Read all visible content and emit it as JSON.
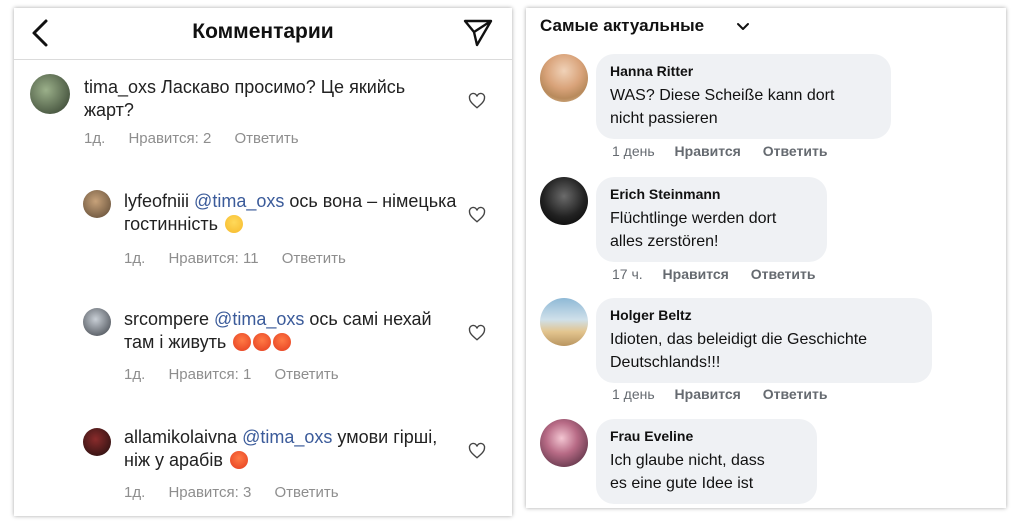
{
  "instagram": {
    "title": "Комментарии",
    "comments": [
      {
        "user": "tima_oxs",
        "mention": "",
        "text": "Ласкаво просимо? Це якийсь жарт?",
        "emoji": [],
        "time": "1д.",
        "likes": "Нравится: 2",
        "reply": "Ответить"
      },
      {
        "user": "lyfeofniii",
        "mention": "@tima_oxs",
        "text": "ось вона – німецька гостинність",
        "emoji": [
          "crying-face"
        ],
        "time": "1д.",
        "likes": "Нравится: 11",
        "reply": "Ответить"
      },
      {
        "user": "srcompere",
        "mention": "@tima_oxs",
        "text": "ось самі нехай там і живуть",
        "emoji": [
          "angry-face",
          "angry-face",
          "angry-face"
        ],
        "time": "1д.",
        "likes": "Нравится: 1",
        "reply": "Ответить"
      },
      {
        "user": "allamikolaivna",
        "mention": "@tima_oxs",
        "text": "умови гірші, ніж у арабів",
        "emoji": [
          "angry-face"
        ],
        "time": "1д.",
        "likes": "Нравится: 3",
        "reply": "Ответить"
      }
    ],
    "icons": {
      "back": "chevron-left-icon",
      "send": "send-icon",
      "like": "heart-icon"
    }
  },
  "facebook": {
    "sort_label": "Самые актуальные",
    "comments": [
      {
        "name": "Hanna Ritter",
        "line1": "WAS? Diese Scheiße kann dort",
        "line2": "nicht passieren",
        "time": "1 день",
        "like": "Нравится",
        "reply": "Ответить"
      },
      {
        "name": "Erich Steinmann",
        "line1": "Flüchtlinge werden dort",
        "line2": "alles zerstören!",
        "time": "17 ч.",
        "like": "Нравится",
        "reply": "Ответить"
      },
      {
        "name": "Holger Beltz",
        "line1": "Idioten, das beleidigt die Geschichte",
        "line2": "Deutschlands!!!",
        "time": "1 день",
        "like": "Нравится",
        "reply": "Ответить"
      },
      {
        "name": "Frau Eveline",
        "line1": "Ich glaube nicht, dass",
        "line2": "es eine gute Idee ist",
        "time": "",
        "like": "",
        "reply": ""
      }
    ],
    "colors": {
      "bubble": "#eff1f4",
      "meta": "#656a70"
    }
  }
}
